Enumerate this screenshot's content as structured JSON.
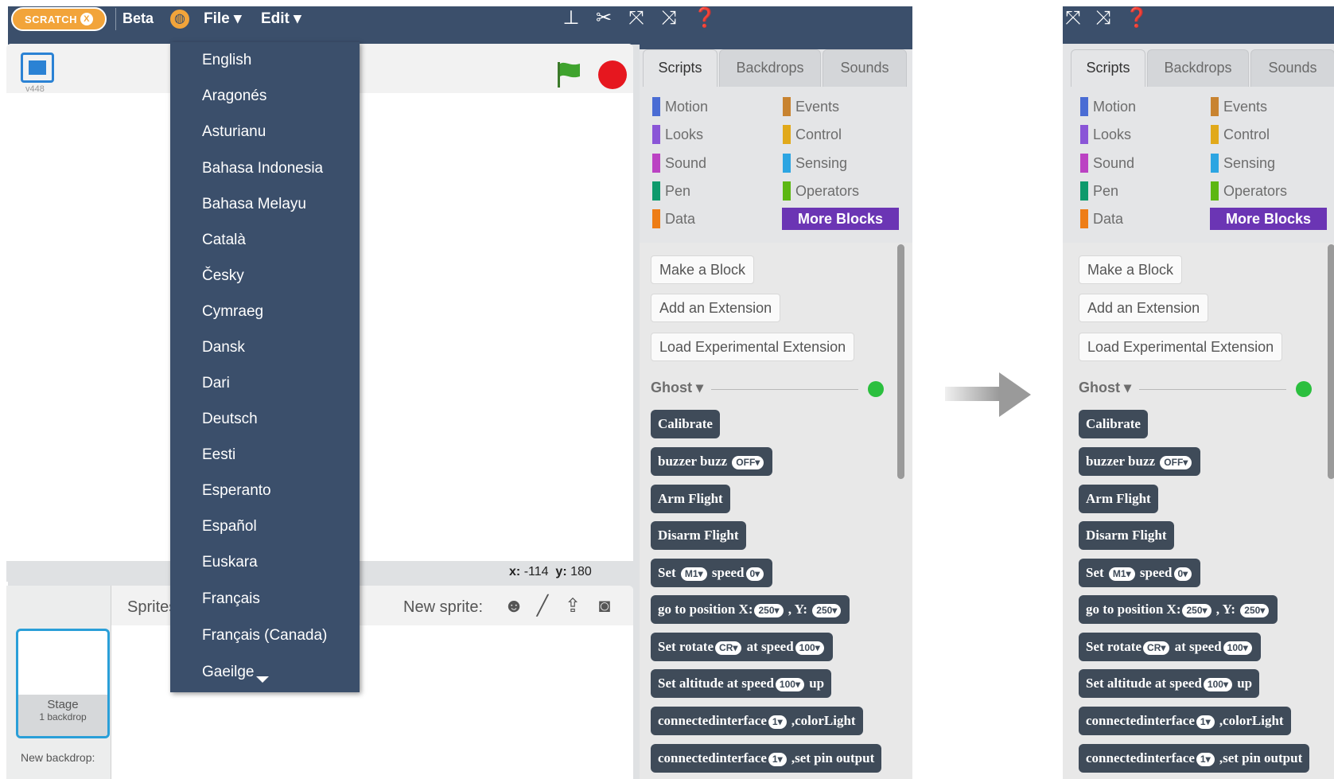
{
  "app": {
    "logo_text": "SCRATCH",
    "logo_badge": "X",
    "beta_label": "Beta"
  },
  "menu": {
    "file_label": "File ▾",
    "edit_label": "Edit ▾"
  },
  "toolbar": {
    "icons": [
      "duplicate-icon",
      "cut-icon",
      "grow-icon",
      "shrink-icon",
      "help-icon"
    ]
  },
  "stage": {
    "version": "v448",
    "x_label": "x:",
    "x_value": "-114",
    "y_label": "y:",
    "y_value": "180"
  },
  "sprites": {
    "label": "Sprites",
    "new_sprite_label": "New sprite:",
    "stage_label": "Stage",
    "stage_sub": "1 backdrop",
    "new_backdrop_label": "New backdrop:"
  },
  "languages": [
    "English",
    "Aragonés",
    "Asturianu",
    "Bahasa Indonesia",
    "Bahasa Melayu",
    "Català",
    "Česky",
    "Cymraeg",
    "Dansk",
    "Dari",
    "Deutsch",
    "Eesti",
    "Esperanto",
    "Español",
    "Euskara",
    "Français",
    "Français (Canada)",
    "Gaeilge"
  ],
  "tabs": {
    "scripts": "Scripts",
    "backdrops": "Backdrops",
    "sounds": "Sounds"
  },
  "categories": {
    "left": [
      {
        "label": "Motion",
        "color": "#4a6cd4"
      },
      {
        "label": "Looks",
        "color": "#8a55d7"
      },
      {
        "label": "Sound",
        "color": "#bb42c3"
      },
      {
        "label": "Pen",
        "color": "#0e9a6c"
      },
      {
        "label": "Data",
        "color": "#ee7d16"
      }
    ],
    "right": [
      {
        "label": "Events",
        "color": "#c88330"
      },
      {
        "label": "Control",
        "color": "#e1a91a"
      },
      {
        "label": "Sensing",
        "color": "#2ca5e2"
      },
      {
        "label": "Operators",
        "color": "#5cb712"
      }
    ],
    "more_blocks": "More Blocks"
  },
  "palette_buttons": {
    "make_block": "Make a Block",
    "add_extension": "Add an Extension",
    "load_experimental": "Load Experimental Extension"
  },
  "extension": {
    "name": "Ghost ▾",
    "status_color": "#2bbf3e"
  },
  "blocks": {
    "calibrate": "Calibrate",
    "buzzer": {
      "text": "buzzer buzz",
      "arg": "OFF▾"
    },
    "arm": "Arm Flight",
    "disarm": "Disarm Flight",
    "set_speed": {
      "t1": "Set",
      "a1": "M1▾",
      "t2": "speed",
      "a2": "0▾"
    },
    "goto": {
      "t1": "go to position X:",
      "a1": "250▾",
      "t2": ", Y:",
      "a2": "250▾"
    },
    "rotate": {
      "t1": "Set rotate",
      "a1": "CR▾",
      "t2": "at speed",
      "a2": "100▾"
    },
    "altitude": {
      "t1": "Set altitude at speed",
      "a1": "100▾",
      "t2": "up"
    },
    "color": {
      "t1": "connectedinterface",
      "a1": "1▾",
      "t2": ",colorLight"
    },
    "pin": {
      "t1": "connectedinterface",
      "a1": "1▾",
      "t2": ",set pin output"
    }
  }
}
